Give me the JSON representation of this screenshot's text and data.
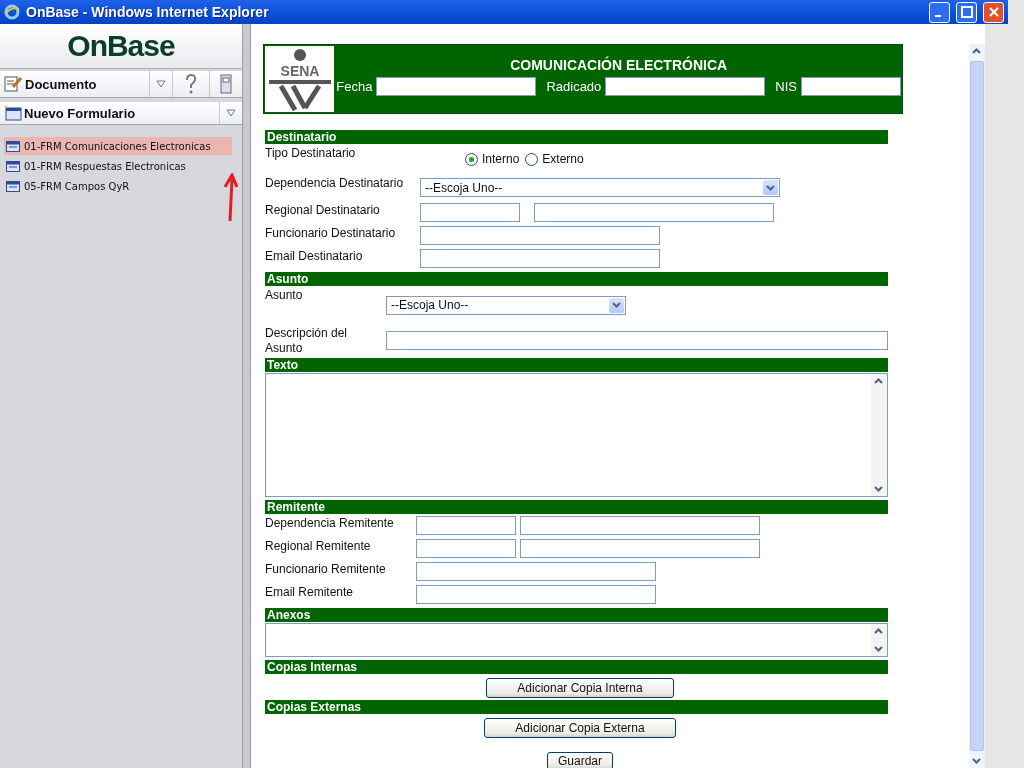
{
  "window": {
    "title": "OnBase - Windows Internet Explorer"
  },
  "sidebar": {
    "logo": "OnBase",
    "menu": {
      "label": "Documento"
    },
    "subheader": "Nuevo Formulario",
    "items": [
      {
        "label": "01-FRM Comunicaciones Electronicas",
        "selected": true
      },
      {
        "label": "01-FRM Respuestas Electronicas",
        "selected": false
      },
      {
        "label": "05-FRM Campos QyR",
        "selected": false
      }
    ]
  },
  "form": {
    "header": {
      "logo_text": "SENA",
      "title": "COMUNICACIÓN ELECTRÓNICA",
      "fields": [
        {
          "label": "Fecha"
        },
        {
          "label": "Radicado"
        },
        {
          "label": "NIS"
        }
      ]
    },
    "sections": [
      {
        "title": "Destinatario",
        "rows": [
          {
            "kind": "radio",
            "label": "Tipo Destinatario",
            "options": [
              {
                "label": "Interno",
                "selected": true
              },
              {
                "label": "Externo",
                "selected": false
              }
            ]
          },
          {
            "kind": "select",
            "label": "Dependencia Destinatario",
            "value": "--Escoja Uno--"
          },
          {
            "kind": "pair",
            "label": "Regional Destinatario"
          },
          {
            "kind": "text",
            "label": "Funcionario Destinatario"
          },
          {
            "kind": "text",
            "label": "Email Destinatario"
          }
        ]
      },
      {
        "title": "Asunto",
        "rows": [
          {
            "kind": "select",
            "label": "Asunto",
            "value": "--Escoja Uno--"
          },
          {
            "kind": "wide",
            "label": "Descripción del Asunto"
          }
        ]
      },
      {
        "title": "Texto",
        "rows": [
          {
            "kind": "textarea"
          }
        ]
      },
      {
        "title": "Remitente",
        "rows": [
          {
            "kind": "pair",
            "label": "Dependencia Remitente"
          },
          {
            "kind": "pair",
            "label": "Regional Remitente"
          },
          {
            "kind": "text",
            "label": "Funcionario Remitente"
          },
          {
            "kind": "text",
            "label": "Email Remitente"
          }
        ]
      },
      {
        "title": "Anexos",
        "rows": [
          {
            "kind": "smallarea"
          }
        ]
      },
      {
        "title": "Copias Internas",
        "rows": [
          {
            "kind": "button",
            "label": "Adicionar Copia Interna"
          }
        ]
      },
      {
        "title": "Copias Externas",
        "rows": [
          {
            "kind": "button",
            "label": "Adicionar Copia Externa"
          }
        ]
      }
    ],
    "submit": "Guardar"
  }
}
